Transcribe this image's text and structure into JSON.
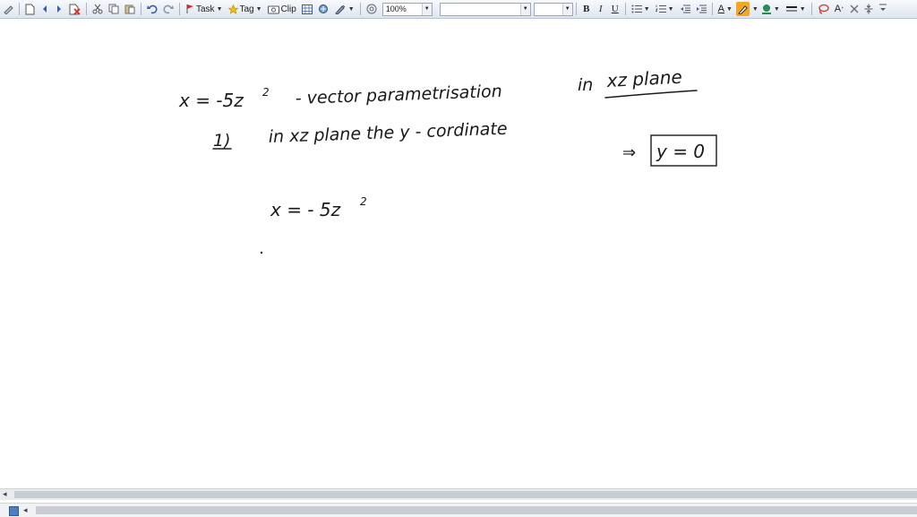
{
  "toolbar": {
    "task_label": "Task",
    "tag_label": "Tag",
    "clip_label": "Clip",
    "zoom_value": "100%",
    "font_name_value": "",
    "font_size_value": "",
    "bold_label": "B",
    "italic_label": "I",
    "underline_label": "U",
    "font_color_label": "A",
    "grow_font_label": "A"
  },
  "note": {
    "line1_eq": "x = -5z",
    "line1_exp": "2",
    "line1_text": "- vector parametrisation",
    "line1_in": "in",
    "line1_plane": "xz plane",
    "line2_num": "1)",
    "line2_text": "in xz plane   the   y - cordinate",
    "implies": "⇒",
    "boxed": "y = 0",
    "line3_eq": "x = - 5z",
    "line3_exp": "2"
  },
  "colors": {
    "toolbar_bg": "#dfe6f0",
    "highlighter": "#f5a623",
    "pen_color": "#2e8b57",
    "flag": "#d9262c",
    "star": "#f2c200"
  }
}
